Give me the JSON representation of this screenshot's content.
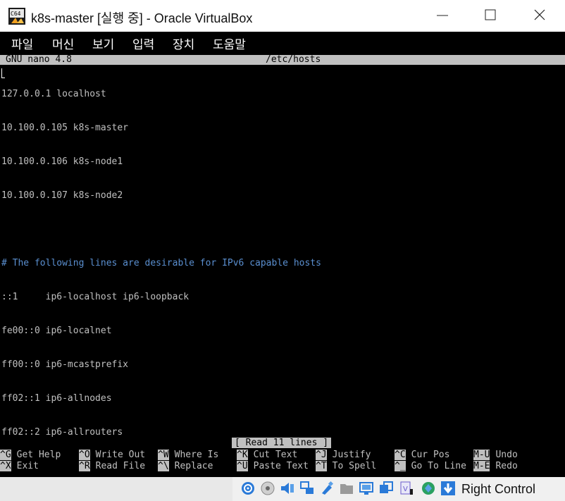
{
  "window": {
    "title": "k8s-master [실행 중] - Oracle VirtualBox",
    "icon": "virtualbox-icon"
  },
  "menu": {
    "items": [
      "파일",
      "머신",
      "보기",
      "입력",
      "장치",
      "도움말"
    ]
  },
  "nano": {
    "version": "GNU nano 4.8",
    "filename": "/etc/hosts",
    "lines": [
      {
        "text": "127.0.0.1 localhost",
        "kind": "normal"
      },
      {
        "text": "10.100.0.105 k8s-master",
        "kind": "normal"
      },
      {
        "text": "10.100.0.106 k8s-node1",
        "kind": "normal"
      },
      {
        "text": "10.100.0.107 k8s-node2",
        "kind": "normal"
      },
      {
        "text": "",
        "kind": "normal"
      },
      {
        "text": "# The following lines are desirable for IPv6 capable hosts",
        "kind": "comment"
      },
      {
        "text": "::1     ip6-localhost ip6-loopback",
        "kind": "normal"
      },
      {
        "text": "fe00::0 ip6-localnet",
        "kind": "normal"
      },
      {
        "text": "ff00::0 ip6-mcastprefix",
        "kind": "normal"
      },
      {
        "text": "ff02::1 ip6-allnodes",
        "kind": "normal"
      },
      {
        "text": "ff02::2 ip6-allrouters",
        "kind": "normal"
      }
    ],
    "status_message": "[ Read 11 lines ]",
    "shortcuts_row1": [
      {
        "key": "^G",
        "label": "Get Help"
      },
      {
        "key": "^O",
        "label": "Write Out"
      },
      {
        "key": "^W",
        "label": "Where Is"
      },
      {
        "key": "^K",
        "label": "Cut Text"
      },
      {
        "key": "^J",
        "label": "Justify"
      },
      {
        "key": "^C",
        "label": "Cur Pos"
      },
      {
        "key": "M-U",
        "label": "Undo"
      }
    ],
    "shortcuts_row2": [
      {
        "key": "^X",
        "label": "Exit"
      },
      {
        "key": "^R",
        "label": "Read File"
      },
      {
        "key": "^\\",
        "label": "Replace"
      },
      {
        "key": "^U",
        "label": "Paste Text"
      },
      {
        "key": "^T",
        "label": "To Spell"
      },
      {
        "key": "^_",
        "label": "Go To Line"
      },
      {
        "key": "M-E",
        "label": "Redo"
      }
    ]
  },
  "statusbar": {
    "host_key": "Right Control",
    "tray_icons": [
      "hard-disk-icon",
      "optical-drive-icon",
      "audio-icon",
      "network-icon",
      "usb-icon",
      "shared-folders-icon",
      "display-icon",
      "video-capture-icon",
      "cpu-virtualization-icon",
      "mouse-integration-icon",
      "keyboard-capture-icon"
    ]
  },
  "colors": {
    "terminal_bg": "#000000",
    "terminal_fg": "#c0c0c0",
    "comment": "#5a8fd0",
    "inverse_bg": "#c0c0c0",
    "tray_blue": "#2a7ad8"
  }
}
